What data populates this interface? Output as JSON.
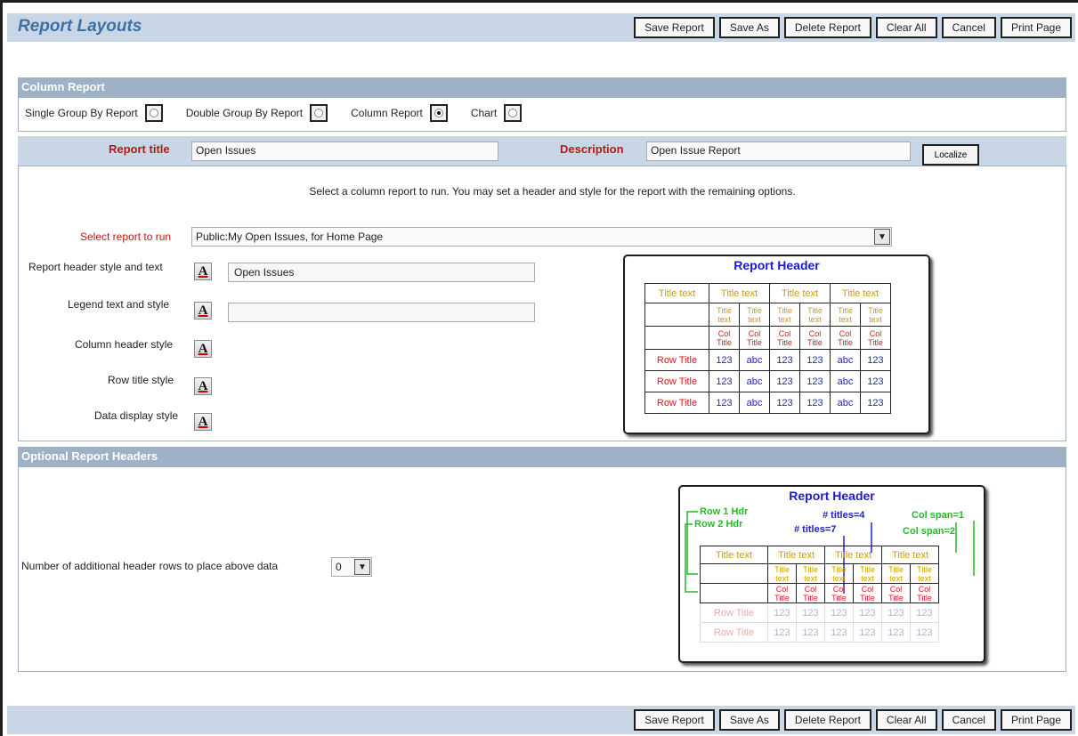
{
  "header": {
    "title": "Report Layouts"
  },
  "actions": {
    "save_report": "Save Report",
    "save_as": "Save As",
    "delete_report": "Delete Report",
    "clear_all": "Clear All",
    "cancel": "Cancel",
    "print_page": "Print Page"
  },
  "column_report": {
    "heading": "Column Report",
    "types": [
      {
        "label": "Single Group By Report",
        "selected": false
      },
      {
        "label": "Double Group By Report",
        "selected": false
      },
      {
        "label": "Column Report",
        "selected": true
      },
      {
        "label": "Chart",
        "selected": false
      }
    ]
  },
  "title_row": {
    "report_title_label": "Report title",
    "report_title_value": "Open Issues",
    "description_label": "Description",
    "description_value": "Open Issue Report",
    "localize_label": "Localize"
  },
  "help_text": "Select a column report to run. You may set a header and style for the report with the remaining options.",
  "select_report": {
    "label": "Select report to run",
    "value": "Public:My Open Issues, for Home Page"
  },
  "style_options": {
    "header_label": "Report header style and text",
    "header_value": "Open Issues",
    "legend_label": "Legend text and style",
    "legend_value": "",
    "column_header_label": "Column header style",
    "row_title_label": "Row title style",
    "data_display_label": "Data display style",
    "style_button_glyph": "A",
    "style_button_icon": "text-style-icon"
  },
  "preview1": {
    "title": "Report Header",
    "title_text": "Title text",
    "title_small": "Title text",
    "col_title": "Col Title",
    "row_title": "Row Title",
    "num": "123",
    "alpha": "abc"
  },
  "optional_headers": {
    "heading": "Optional Report Headers",
    "rows_label": "Number of additional header rows to place above data",
    "rows_value": "0"
  },
  "preview2": {
    "title": "Report Header",
    "row1_hdr": "Row 1 Hdr",
    "row2_hdr": "Row 2 Hdr",
    "titles4": "# titles=4",
    "titles7": "# titles=7",
    "colspan1": "Col span=1",
    "colspan2": "Col span=2",
    "title_text": "Title text",
    "title_small": "Title text",
    "col_title": "Col Title",
    "row_title": "Row Title",
    "num": "123"
  },
  "colors": {
    "header_bg": "#c9d6e6",
    "section_bg": "#9fb1c6",
    "title_blue": "#3f6fa3",
    "label_red": "#b31a1a"
  }
}
